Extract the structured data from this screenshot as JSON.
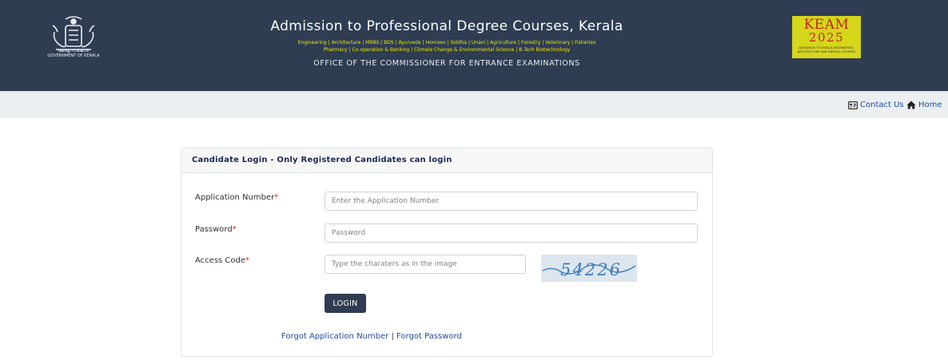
{
  "header": {
    "emblem_caption_line1": "കേരള സർക്കാർ",
    "emblem_caption_line2": "GOVERNMENT OF KERALA",
    "title": "Admission to Professional Degree Courses, Kerala",
    "courses_line1": "Engineering | Architecture | MBBS | BDS | Ayurveda | Homoeo | Siddha | Unani | Agriculture | Forestry | Veterinary | Fisheries",
    "courses_line2": "Pharmacy | Co-operation & Banking | Climate Change & Environmental Science | B.Tech Biotechnology",
    "office": "OFFICE OF THE COMMISSIONER FOR ENTRANCE EXAMINATIONS",
    "logo": {
      "line1": "KEAM",
      "line2": "2025",
      "caption": "ADMISSION TO KERALA ENGINEERING, ARCHITECTURE AND MEDICAL COURSES"
    }
  },
  "nav": {
    "contact": "Contact Us",
    "home": "Home",
    "contact_icon": "contact-card-icon",
    "home_icon": "home-icon"
  },
  "login": {
    "title": "Candidate Login - Only Registered Candidates can login",
    "app_label": "Application Number",
    "app_placeholder": "Enter the Application Number",
    "pwd_label": "Password",
    "pwd_placeholder": "Password",
    "code_label": "Access Code",
    "code_placeholder": "Type the charaters as in the image",
    "required_mark": "*",
    "captcha_text": "54226",
    "button": "LOGIN",
    "forgot_app": "Forgot Application Number",
    "separator": "|",
    "forgot_pwd": "Forgot Password"
  },
  "colors": {
    "header_bg": "#2e3d52",
    "accent_yellow": "#f2e600",
    "link_blue": "#1f4aa8",
    "required_red": "#e0231f"
  }
}
